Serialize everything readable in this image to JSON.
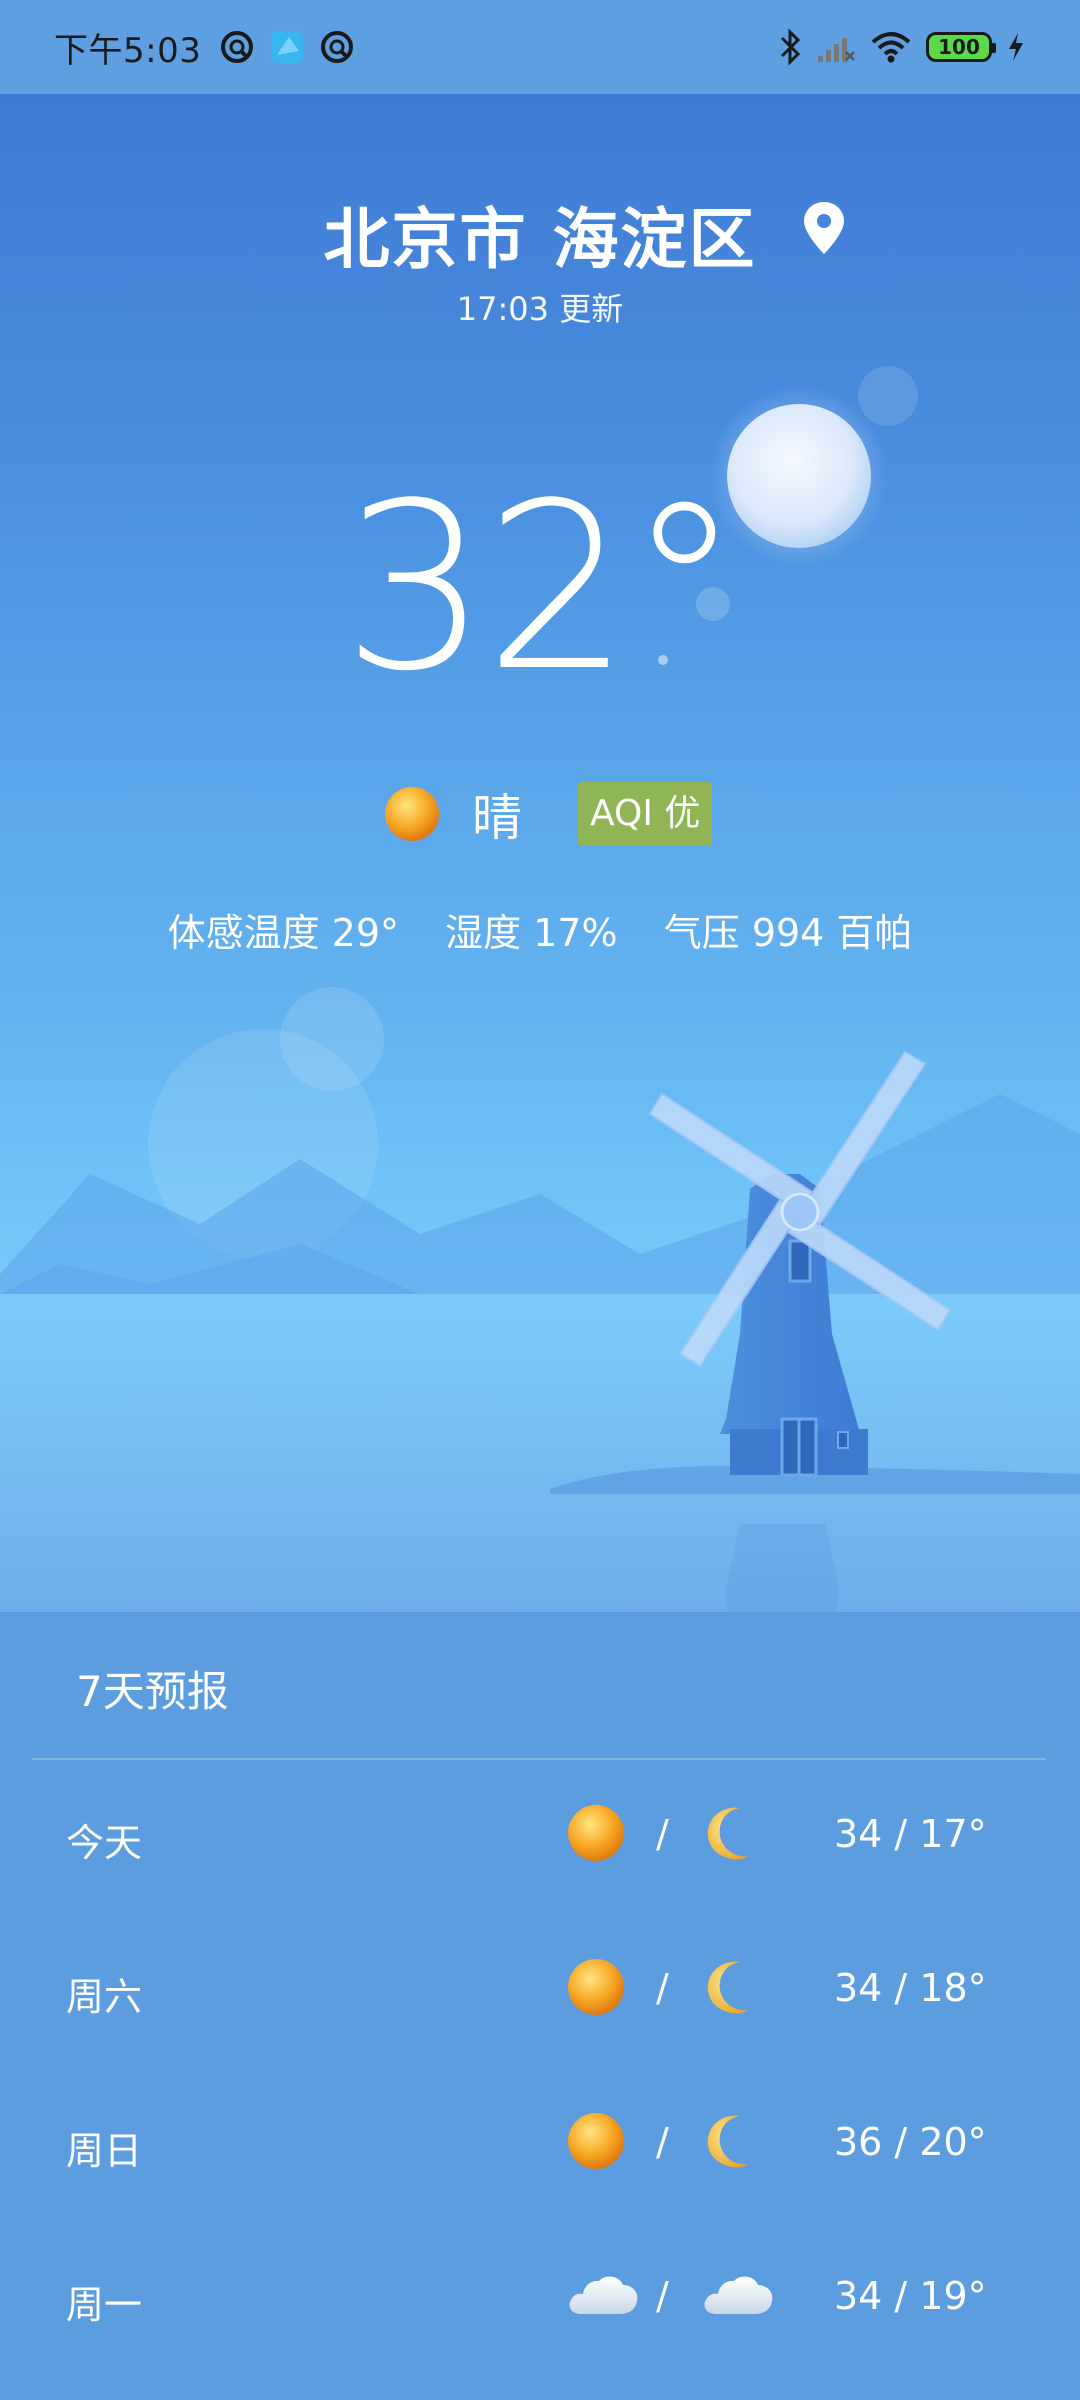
{
  "status_bar": {
    "time": "下午5:03",
    "battery": "100",
    "icons": [
      "alarm-icon",
      "app-icon",
      "alarm-icon",
      "bluetooth-icon",
      "signal-icon",
      "wifi-icon",
      "battery-icon",
      "charging-icon"
    ]
  },
  "location": {
    "name": "北京市 海淀区",
    "updated": "17:03 更新"
  },
  "current": {
    "temperature": "32°",
    "condition": "晴",
    "aqi": "AQI 优",
    "feels_like": "体感温度 29°",
    "humidity": "湿度 17%",
    "pressure": "气压 994 百帕"
  },
  "forecast": {
    "title": "7天预报",
    "days": [
      {
        "day": "今天",
        "day_icon": "sun",
        "night_icon": "moon",
        "temp": "34 / 17°"
      },
      {
        "day": "周六",
        "day_icon": "sun",
        "night_icon": "moon",
        "temp": "34 / 18°"
      },
      {
        "day": "周日",
        "day_icon": "sun",
        "night_icon": "moon",
        "temp": "36 / 20°"
      },
      {
        "day": "周一",
        "day_icon": "cloud",
        "night_icon": "cloud",
        "temp": "34 / 19°"
      }
    ],
    "slash": "/"
  },
  "colors": {
    "aqi_badge": "#8fb555",
    "sun": "#f5a623",
    "sky_top": "#3f7bd4",
    "panel": "#5b9ddf"
  }
}
